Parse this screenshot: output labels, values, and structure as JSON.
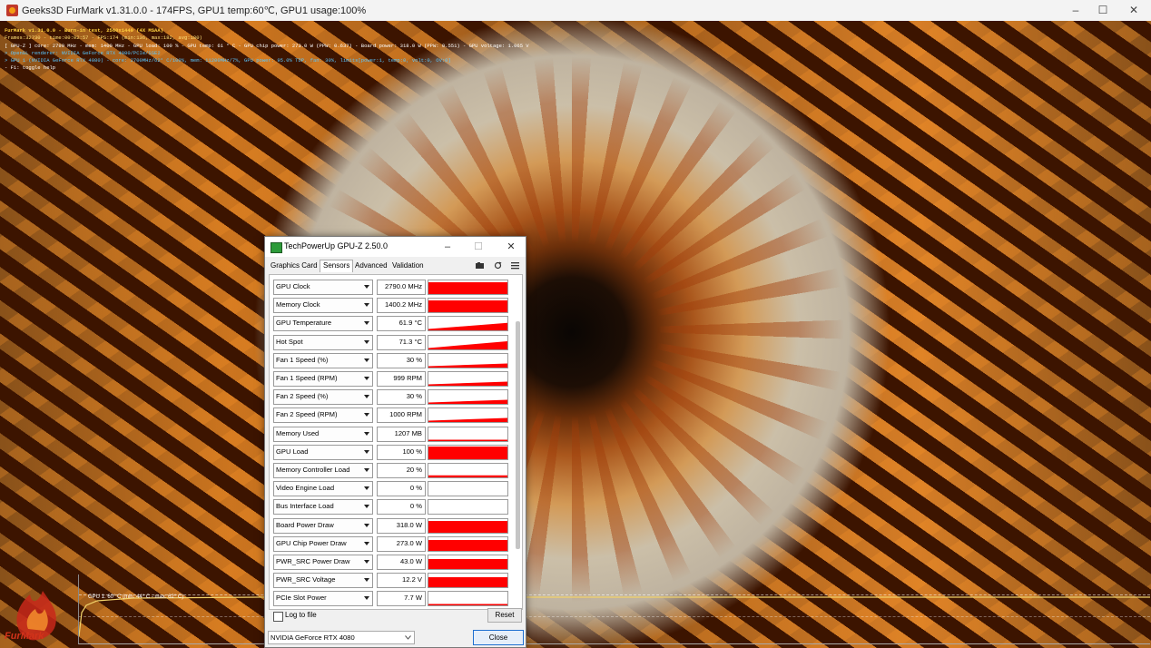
{
  "window": {
    "title": "Geeks3D FurMark v1.31.0.0 - 174FPS, GPU1 temp:60℃, GPU1 usage:100%",
    "controls": [
      "–",
      "☐",
      "✕"
    ]
  },
  "overlay": {
    "lines": [
      "FurMark v1.31.0.0 - Burn-in test, 2560x1440 (4X MSAA)",
      "Frames:32730 - time:00:02:57 - FPS:174 (min:136, max:182, avg:180)",
      "[ GPU-Z ] core: 2790 MHz - mem: 1400 MHz - GPU load: 100 % - GPU temp: 61 ° C - GPU chip power: 273.0 W (PPW: 0.637) - Board power: 318.0 W (PPW: 0.551) - GPU voltage: 1.065 V",
      "> OpenGL renderer: NVIDIA GeForce RTX 4080/PCIe/SSE2",
      "> GPU 1 (NVIDIA GeForce RTX 4080) - core: 2700MHz/62° C/100%, mem: 11200MHz/7%, GPU power: 95.0% TDP, fan: 30%, limits[power:1, temp:0, volt:0, OV:0]",
      "- F1: toggle help"
    ],
    "graph_label": "GPU 1: 60° C (min: 44° C - max: 62° C)",
    "logo_text": "FurMark"
  },
  "gpuz": {
    "title": "TechPowerUp GPU-Z 2.50.0",
    "controls": [
      "–",
      "☐",
      "✕"
    ],
    "tabs": [
      "Graphics Card",
      "Sensors",
      "Advanced",
      "Validation"
    ],
    "active_tab": "Sensors",
    "tool_icons": [
      "camera-icon",
      "refresh-icon",
      "menu-icon"
    ],
    "sensors": [
      {
        "name": "GPU Clock",
        "value": "2790.0 MHz",
        "level": 0.85,
        "pattern": "full"
      },
      {
        "name": "Memory Clock",
        "value": "1400.2 MHz",
        "level": 0.85,
        "pattern": "full"
      },
      {
        "name": "GPU Temperature",
        "value": "61.9 °C",
        "level": 0.55,
        "pattern": "ramp"
      },
      {
        "name": "Hot Spot",
        "value": "71.3 °C",
        "level": 0.6,
        "pattern": "ramp"
      },
      {
        "name": "Fan 1 Speed (%)",
        "value": "30 %",
        "level": 0.3,
        "pattern": "ramp"
      },
      {
        "name": "Fan 1 Speed (RPM)",
        "value": "999 RPM",
        "level": 0.3,
        "pattern": "ramp"
      },
      {
        "name": "Fan 2 Speed (%)",
        "value": "30 %",
        "level": 0.3,
        "pattern": "ramp"
      },
      {
        "name": "Fan 2 Speed (RPM)",
        "value": "1000 RPM",
        "level": 0.3,
        "pattern": "ramp"
      },
      {
        "name": "Memory Used",
        "value": "1207 MB",
        "level": 0.1,
        "pattern": "line"
      },
      {
        "name": "GPU Load",
        "value": "100 %",
        "level": 0.95,
        "pattern": "full"
      },
      {
        "name": "Memory Controller Load",
        "value": "20 %",
        "level": 0.15,
        "pattern": "line"
      },
      {
        "name": "Video Engine Load",
        "value": "0 %",
        "level": 0,
        "pattern": "none"
      },
      {
        "name": "Bus Interface Load",
        "value": "0 %",
        "level": 0,
        "pattern": "none"
      },
      {
        "name": "Board Power Draw",
        "value": "318.0 W",
        "level": 0.85,
        "pattern": "full"
      },
      {
        "name": "GPU Chip Power Draw",
        "value": "273.0 W",
        "level": 0.8,
        "pattern": "full"
      },
      {
        "name": "PWR_SRC Power Draw",
        "value": "43.0 W",
        "level": 0.75,
        "pattern": "full"
      },
      {
        "name": "PWR_SRC Voltage",
        "value": "12.2 V",
        "level": 0.75,
        "pattern": "full"
      },
      {
        "name": "PCIe Slot Power",
        "value": "7.7 W",
        "level": 0.1,
        "pattern": "line"
      }
    ],
    "log_to_file": "Log to file",
    "reset": "Reset",
    "device": "NVIDIA GeForce RTX 4080",
    "close": "Close",
    "accent": "#ff0000"
  }
}
